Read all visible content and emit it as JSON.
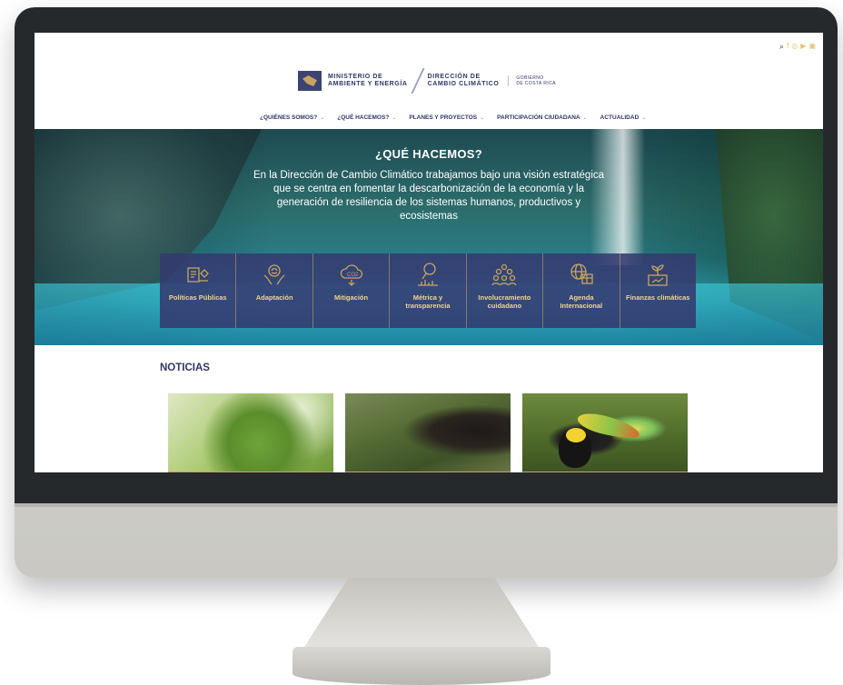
{
  "site": {
    "topbar_icons": [
      "search-icon",
      "facebook-icon",
      "instagram-icon",
      "youtube-icon",
      "linkedin-icon"
    ],
    "logos": {
      "ministry_line1": "MINISTERIO DE",
      "ministry_line2": "AMBIENTE Y ENERGÍA",
      "direction_line1": "DIRECCIÓN DE",
      "direction_line2": "CAMBIO CLIMÁTICO",
      "gov_line1": "GOBIERNO",
      "gov_line2": "DE COSTA RICA"
    },
    "nav": [
      {
        "label": "¿QUIÉNES SOMOS?"
      },
      {
        "label": "¿QUÉ HACEMOS?"
      },
      {
        "label": "PLANES Y PROYECTOS"
      },
      {
        "label": "PARTICIPACIÓN CIUDADANA"
      },
      {
        "label": "ACTUALIDAD"
      }
    ]
  },
  "hero": {
    "title": "¿QUÉ HACEMOS?",
    "text": "En la Dirección de Cambio Climático trabajamos bajo una visión estratégica que se centra en fomentar la descarbonización de la economía y la generación de resiliencia de los sistemas humanos, productivos y ecosistemas",
    "cards": [
      {
        "label": "Políticas Públicas",
        "icon": "policy-icon"
      },
      {
        "label": "Adaptación",
        "icon": "adaptation-icon"
      },
      {
        "label": "Mitigación",
        "icon": "co2-cloud-icon"
      },
      {
        "label": "Métrica y transparencia",
        "icon": "magnifier-chart-icon"
      },
      {
        "label": "Involucramiento cuidadano",
        "icon": "people-icon"
      },
      {
        "label": "Agenda Internacional",
        "icon": "globe-icon"
      },
      {
        "label": "Finanzas climáticas",
        "icon": "plant-chart-icon"
      }
    ]
  },
  "news": {
    "title": "NOTICIAS"
  },
  "colors": {
    "navy": "#2f3667",
    "card_bg": "#343a70",
    "gold": "#c7a45f",
    "card_text": "#f1d68a"
  }
}
